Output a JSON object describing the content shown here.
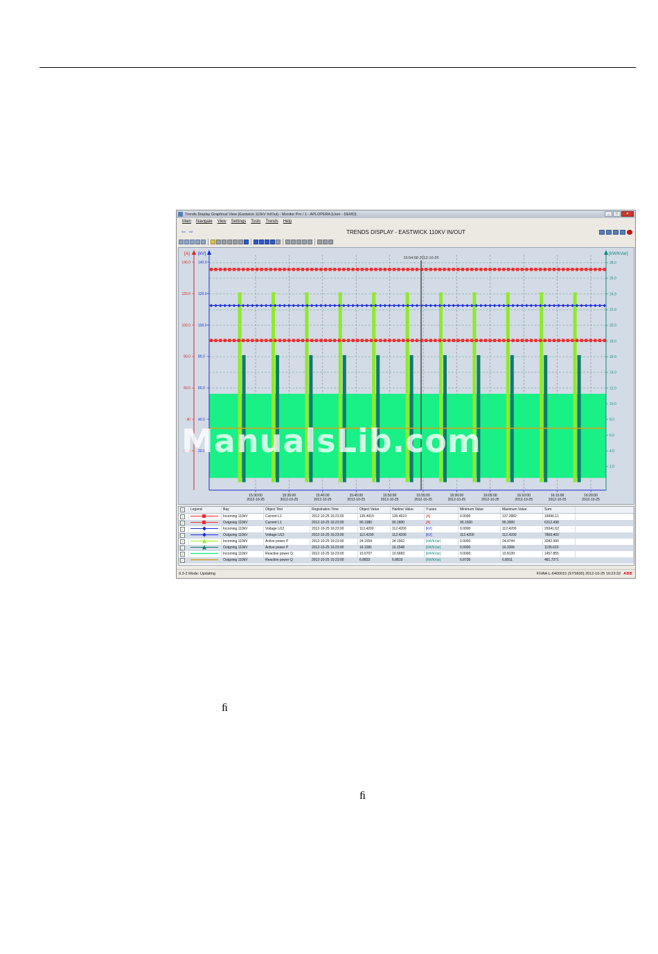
{
  "window": {
    "title": "Trends Display Graphical View (Eastwick 110kV In/Out) - Monitor Pro / 1 - APLOPERA [User - DEMO]",
    "controls": [
      "_",
      "□",
      "✕"
    ]
  },
  "menu": [
    "Main",
    "Navigate",
    "View",
    "Settings",
    "Tools",
    "Trends",
    "Help"
  ],
  "display_title": "TRENDS DISPLAY - EASTWICK 110KV IN/OUT",
  "chart_data": {
    "type": "line",
    "hairline_label": "15:54:58 2012-10-25",
    "axes": {
      "left_a": {
        "label": "[A]",
        "ticks": [
          "140.0",
          "120.0",
          "100.0",
          "80.0",
          "60.0",
          "40",
          "20.0"
        ],
        "values": [
          140,
          120,
          100,
          80,
          60,
          40,
          20
        ],
        "color": "#e02020"
      },
      "left_kv": {
        "label": "[kV]",
        "ticks": [
          "140.0",
          "120.0",
          "100.0",
          "80.0",
          "60.0",
          "40.0",
          "20.0"
        ],
        "values": [
          140,
          120,
          100,
          80,
          60,
          40,
          20
        ],
        "color": "#1a2ad8"
      },
      "right": {
        "label": "[kW/kVar]",
        "ticks": [
          "28.0",
          "26.0",
          "24.0",
          "22.0",
          "20.0",
          "18.0",
          "16.0",
          "14.0",
          "12.0",
          "10.0",
          "8.0",
          "6.0",
          "4.0",
          "2.0"
        ],
        "values": [
          28,
          26,
          24,
          22,
          20,
          18,
          16,
          14,
          12,
          10,
          8,
          6,
          4,
          2
        ],
        "color": "#11887a"
      }
    },
    "x_ticks": [
      {
        "time": "15:30:00",
        "date": "2012-10-25"
      },
      {
        "time": "15:35:00",
        "date": "2012-10-25"
      },
      {
        "time": "15:40:00",
        "date": "2012-10-25"
      },
      {
        "time": "15:45:00",
        "date": "2012-10-25"
      },
      {
        "time": "15:50:00",
        "date": "2012-10-25"
      },
      {
        "time": "15:55:00",
        "date": "2012-10-25"
      },
      {
        "time": "16:00:00",
        "date": "2012-10-25"
      },
      {
        "time": "16:05:00",
        "date": "2012-10-25"
      },
      {
        "time": "16:10:00",
        "date": "2012-10-25"
      },
      {
        "time": "16:15:00",
        "date": "2012-10-25"
      },
      {
        "time": "16:20:00",
        "date": "2012-10-25"
      }
    ],
    "series": [
      {
        "name": "Incoming 110kV Current L1",
        "axis": "A",
        "value": 135.4,
        "color": "#ee2b2b",
        "marker": "square"
      },
      {
        "name": "Outgoing 110kV Current L1",
        "axis": "A",
        "value": 90.2,
        "color": "#ee2b2b",
        "marker": "square"
      },
      {
        "name": "Incoming 110kV Voltage U12",
        "axis": "kV",
        "value": 112.4,
        "color": "#1a2ad8",
        "marker": "diamond"
      },
      {
        "name": "Incoming 110kV Active power P",
        "axis": "kW",
        "style": "spikes",
        "value": 24.2,
        "color": "#8fea2a"
      },
      {
        "name": "Outgoing 110kV Active power P",
        "axis": "kW",
        "style": "spikes",
        "value": 16.2,
        "color": "#0f7b6e"
      },
      {
        "name": "Incoming 110kV Reactive power Q",
        "axis": "kW",
        "style": "area",
        "value": 10.67,
        "color": "#19f086"
      },
      {
        "name": "Outgoing 110kV Reactive power Q",
        "axis": "kW",
        "style": "line",
        "value": 6.88,
        "color": "#d99f22"
      }
    ]
  },
  "legend": {
    "headers": [
      "Legend",
      "Bay",
      "Object Text",
      "Registration Time",
      "Object Value",
      "Hairline Value",
      "Y-axes",
      "Minimum Value",
      "Maximum Value",
      "Sum"
    ],
    "rows": [
      {
        "bay": "Incoming 110kV",
        "obj": "Current L1",
        "time": "2012-10-25 16:23:00",
        "value": "135.4915",
        "hair": "135.4619",
        "axis": "[A]",
        "min": "0.0000",
        "max": "137.2882",
        "sum": "18496.11",
        "color": "#ee2b2b",
        "marker": "square"
      },
      {
        "bay": "Outgoing 110kV",
        "obj": "Current L1",
        "time": "2012-10-25 16:23:00",
        "value": "90.1980",
        "hair": "90.1800",
        "axis": "[A]",
        "min": "90.1500",
        "max": "90.3000",
        "sum": "6312.498",
        "color": "#ee2b2b",
        "marker": "square"
      },
      {
        "bay": "Incoming 110kV",
        "obj": "Voltage U12",
        "time": "2012-10-25 16:23:00",
        "value": "112.4200",
        "hair": "112.4200",
        "axis": "[kV]",
        "min": "0.0000",
        "max": "112.4200",
        "sum": "29341.62",
        "color": "#1a2ad8",
        "marker": "diamond"
      },
      {
        "bay": "Outgoing 110kV",
        "obj": "Voltage U12",
        "time": "2012-10-25 16:23:00",
        "value": "112.4200",
        "hair": "112.4200",
        "axis": "[kV]",
        "min": "112.4200",
        "max": "112.4200",
        "sum": "7869.400",
        "color": "#1a2ad8",
        "marker": "diamond"
      },
      {
        "bay": "Incoming 110kV",
        "obj": "Active power P",
        "time": "2012-10-25 16:23:00",
        "value": "24.1554",
        "hair": "24.1502",
        "axis": "[kW/kVar]",
        "min": "0.0000",
        "max": "24.4744",
        "sum": "3282.990",
        "color": "#8fea2a",
        "marker": "triangle"
      },
      {
        "bay": "Outgoing 110kV",
        "obj": "Active power P",
        "time": "2012-10-25 16:23:00",
        "value": "16.1581",
        "hair": "16.1548",
        "axis": "[kW/kVar]",
        "min": "0.0000",
        "max": "16.3306",
        "sum": "1195.620",
        "color": "#0f7b6e",
        "marker": "triangle"
      },
      {
        "bay": "Incoming 110kV",
        "obj": "Reactive power Q",
        "time": "2012-10-25 16:23:00",
        "value": "10.6707",
        "hair": "10.6683",
        "axis": "[kW/kVar]",
        "min": "0.0000",
        "max": "10.8139",
        "sum": "1457.855",
        "color": "#19f086",
        "marker": "none"
      },
      {
        "bay": "Outgoing 110kV",
        "obj": "Reactive power Q",
        "time": "2012-10-25 16:23:00",
        "value": "6.8833",
        "hair": "6.8819",
        "axis": "[kW/kVar]",
        "min": "6.8736",
        "max": "6.8911",
        "sum": "481.7271",
        "color": "#d99f22",
        "marker": "none"
      }
    ]
  },
  "status": {
    "left": "9.3-2   Mode: Updating",
    "right": "FIVAA-L-6400015 (SYS600)   2012-10-25 16:23:32",
    "brand": "ABB"
  },
  "watermark": "ManualsLib.com",
  "ligature_1": "ﬁ",
  "ligature_2": "ﬁ"
}
